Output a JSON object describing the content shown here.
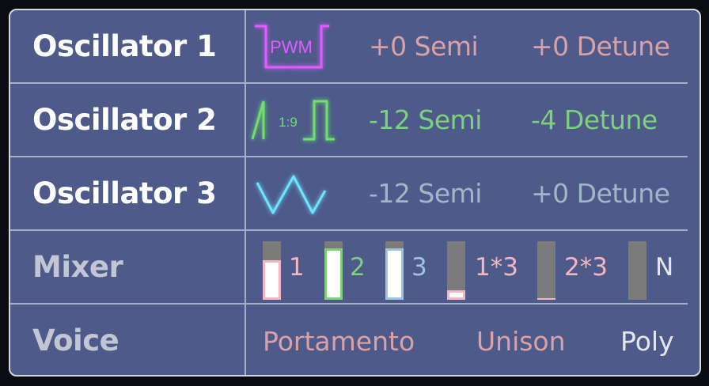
{
  "oscillators": [
    {
      "label": "Oscillator 1",
      "wave_icon": "pwm-wave-icon",
      "wave_text": "PWM",
      "semi": "+0 Semi",
      "detune": "+0 Detune",
      "color": "#d9a2a7",
      "icon_color": "#e25bff"
    },
    {
      "label": "Oscillator 2",
      "wave_icon": "saw-square-wave-icon",
      "wave_text": "1:9",
      "semi": "-12 Semi",
      "detune": "-4 Detune",
      "color": "#7ed07b",
      "icon_color": "#6fe06c"
    },
    {
      "label": "Oscillator 3",
      "wave_icon": "triangle-wave-icon",
      "semi": "-12 Semi",
      "detune": "+0 Detune",
      "color": "#9fb7c7",
      "icon_color": "#6ee3ff"
    }
  ],
  "mixer": {
    "label": "Mixer",
    "channels": [
      {
        "label": "1",
        "level": 0.68,
        "color": "#f3b6c2"
      },
      {
        "label": "2",
        "level": 0.88,
        "color": "#7ed07b"
      },
      {
        "label": "3",
        "level": 0.88,
        "color": "#9fc4e0"
      },
      {
        "label": "1*3",
        "level": 0.16,
        "color": "#f3b6c2"
      },
      {
        "label": "2*3",
        "level": 0.03,
        "color": "#f3b6c2"
      },
      {
        "label": "N",
        "level": 0.0,
        "color": "#e6e6ee"
      }
    ]
  },
  "voice": {
    "label": "Voice",
    "modes": [
      "Portamento",
      "Unison",
      "Poly"
    ],
    "mode_colors": [
      "#d9a2a7",
      "#d9a2a7",
      "#e6e6ee"
    ]
  }
}
